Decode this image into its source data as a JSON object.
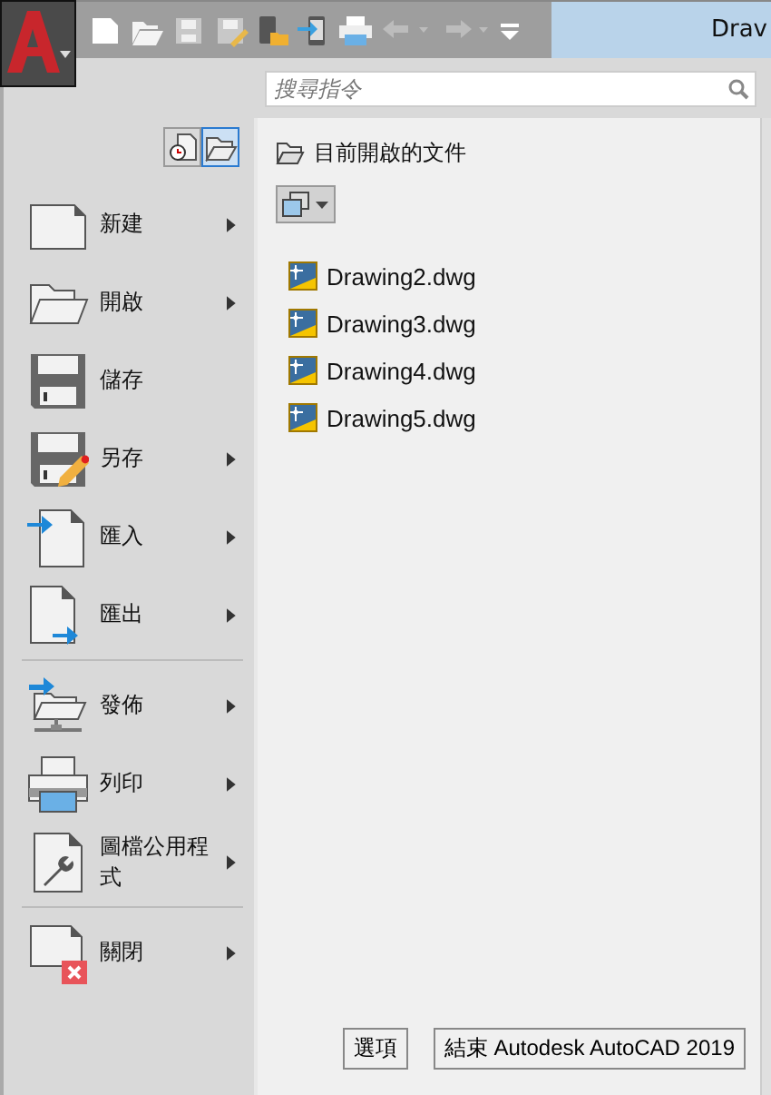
{
  "title_bar": {
    "title": "Drav"
  },
  "search": {
    "placeholder": "搜尋指令"
  },
  "view_toggle": [
    {
      "selected": false
    },
    {
      "selected": true
    }
  ],
  "menu_sections": [
    {
      "items": [
        {
          "label": "新建",
          "submenu": true
        },
        {
          "label": "開啟",
          "submenu": true
        },
        {
          "label": "儲存",
          "submenu": false
        },
        {
          "label": "另存",
          "submenu": true
        },
        {
          "label": "匯入",
          "submenu": true
        },
        {
          "label": "匯出",
          "submenu": true
        }
      ]
    },
    {
      "items": [
        {
          "label": "發佈",
          "submenu": true
        },
        {
          "label": "列印",
          "submenu": true
        },
        {
          "label": "圖檔公用程式",
          "submenu": true
        }
      ]
    },
    {
      "items": [
        {
          "label": "關閉",
          "submenu": true
        }
      ]
    }
  ],
  "documents": {
    "heading": "目前開啟的文件",
    "files": [
      "Drawing2.dwg",
      "Drawing3.dwg",
      "Drawing4.dwg",
      "Drawing5.dwg"
    ]
  },
  "buttons": [
    "選項",
    "結束 Autodesk AutoCAD 2019"
  ]
}
